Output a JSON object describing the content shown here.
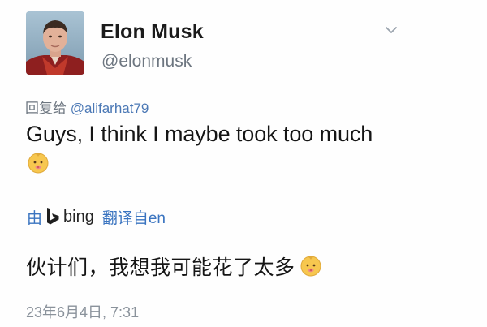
{
  "profile": {
    "display_name": "Elon Musk",
    "handle": "@elonmusk",
    "avatar": "profile-photo"
  },
  "reply": {
    "prefix": "回复给 ",
    "mention": "@alifarhat79"
  },
  "tweet": {
    "text": "Guys, I think I maybe took too much",
    "emoji": "baby-face-icon"
  },
  "translation": {
    "by_label": "由",
    "provider": "bing",
    "provider_icon": "bing-logo-icon",
    "translated_from": "翻译自en",
    "text": "伙计们，我想我可能花了太多"
  },
  "timestamp": "23年6月4日, 7:31",
  "colors": {
    "link": "#3a74c0",
    "muted": "#6d7680",
    "text": "#151515",
    "emoji_face": "#f7c74f",
    "background": "#fefefe"
  },
  "icons": {
    "menu": "chevron-down-icon"
  }
}
